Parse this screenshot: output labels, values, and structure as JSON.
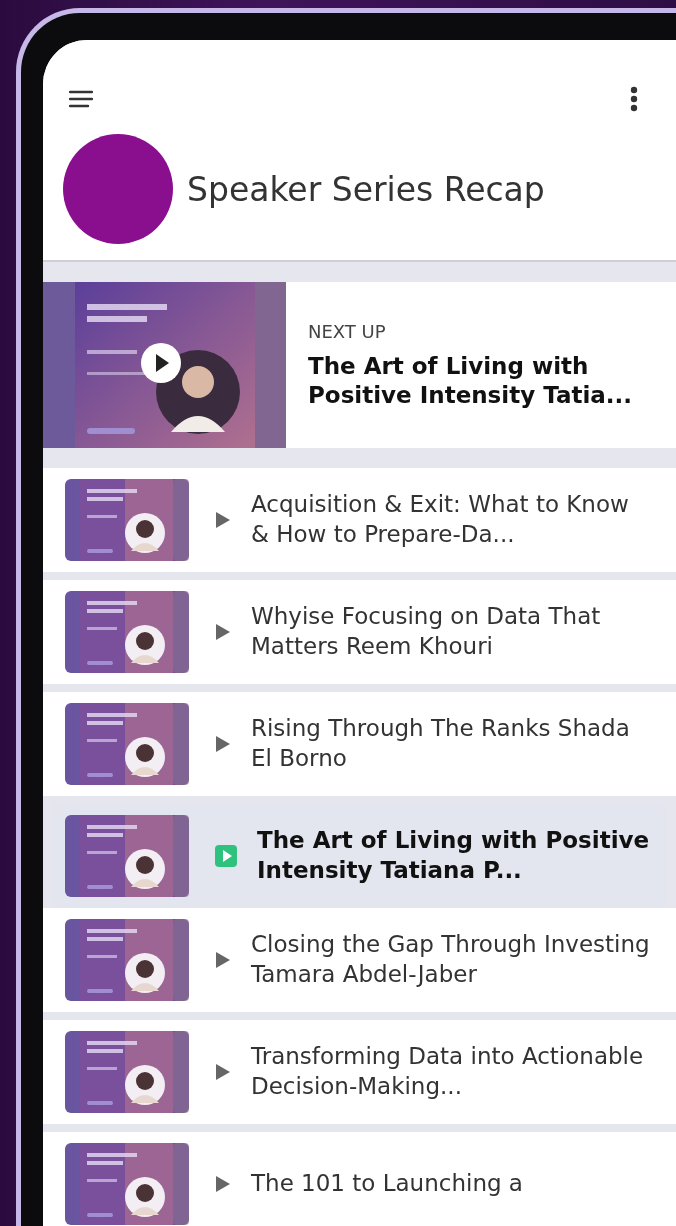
{
  "app_bar": {
    "title": "Speaker Series Recap"
  },
  "next_up": {
    "label": "NEXT UP",
    "title": "The Art of Living with Positive Intensity Tatia..."
  },
  "playlist": [
    {
      "title": "Acquisition & Exit: What to Know & How to Prepare-Da...",
      "selected": false
    },
    {
      "title": "Whyise Focusing on Data That Matters Reem Khouri",
      "selected": false
    },
    {
      "title": "Rising Through The Ranks Shada El Borno",
      "selected": false
    },
    {
      "title": "The Art of Living with Positive Intensity Tatiana P...",
      "selected": true
    },
    {
      "title": "Closing the Gap Through Investing Tamara Abdel-Jaber",
      "selected": false
    },
    {
      "title": "Transforming Data into Actionable Decision-Making...",
      "selected": false
    },
    {
      "title": "The 101 to Launching a",
      "selected": false
    }
  ]
}
